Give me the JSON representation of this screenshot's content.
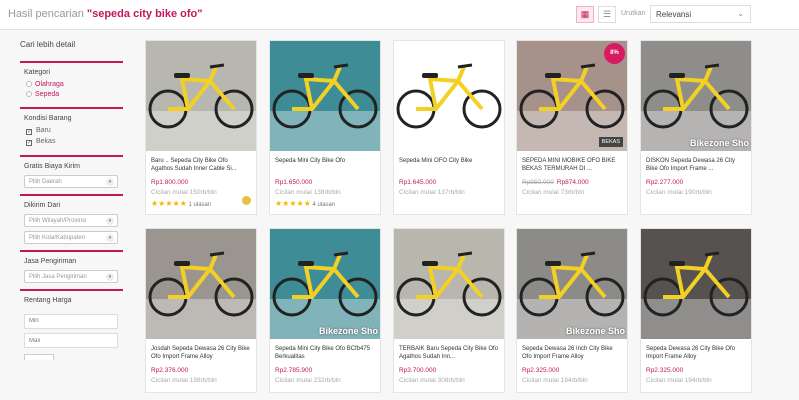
{
  "header": {
    "search_prefix": "Hasil pencarian",
    "search_query": "\"sepeda city bike ofo\"",
    "sort_label": "Urutkan",
    "sort_value": "Relevansi"
  },
  "sidebar": {
    "heading": "Cari lebih detail",
    "kategori": {
      "title": "Kategori",
      "options": [
        "Olahraga",
        "Sepeda"
      ]
    },
    "kondisi": {
      "title": "Kondisi Barang",
      "options": [
        "Baru",
        "Bekas"
      ]
    },
    "gratis": {
      "title": "Gratis Biaya Kirim",
      "select": "Pilih Daerah"
    },
    "dikirim": {
      "title": "Dikirim Dari",
      "select1": "Pilih Wilayah/Provinsi",
      "select2": "Pilih Kota/Kabupaten"
    },
    "jasa": {
      "title": "Jasa Pengiriman",
      "select": "Pilih Jasa Pengiriman"
    },
    "harga": {
      "title": "Rentang Harga",
      "min_placeholder": "Min",
      "max_placeholder": "Max"
    }
  },
  "products": [
    {
      "name": "Baru .. Sepeda City Bike Ofo Agathos Sudah Inner Cable Si...",
      "price": "Rp1.800.000",
      "cicilan": "Cicilan mulai 150rb/bln",
      "rating": "★★★★★",
      "reviews": "1 ulasan",
      "bg": "#b7b7b0"
    },
    {
      "name": "Sepeda Mini City Bike Ofo",
      "price": "Rp1.650.000",
      "cicilan": "Cicilan mulai 138rb/bln",
      "rating": "★★★★★",
      "reviews": "4 ulasan",
      "bg": "#3d8c96"
    },
    {
      "name": "Sepeda Mini OFO City Bike",
      "price": "Rp1.645.000",
      "cicilan": "Cicilan mulai 137rb/bln",
      "bg": "#ffffff"
    },
    {
      "name": "SEPEDA MINI MOBIKE OFO BIKE BEKAS TERMURAH DI ...",
      "old_price": "Rp950.000",
      "price": "Rp874.000",
      "cicilan": "Cicilan mulai 73rb/bln",
      "badge": "8%",
      "tag": "BEKAS",
      "bg": "#a6928a"
    },
    {
      "name": "DISKON Sepeda Dewasa 26 City Bike Ofo Import Frame ...",
      "price": "Rp2.277.000",
      "cicilan": "Cicilan mulai 190rb/bln",
      "watermark": "Bikezone Sho",
      "bg": "#8f8d8a"
    },
    {
      "name": "Josdah Sepeda Dewasa 26 City Bike Ofo Import Frame Alloy",
      "price": "Rp2.376.000",
      "cicilan": "Cicilan mulai 198rb/bln",
      "bg": "#9a968f"
    },
    {
      "name": "Sepeda Mini City Bike Ofo BCfb475 Berkualitas",
      "price": "Rp2.785.900",
      "cicilan": "Cicilan mulai 232rb/bln",
      "watermark": "Bikezone Sho",
      "bg": "#3d8c96"
    },
    {
      "name": "TERBAIK Baru Sepeda City Bike Ofo Agathos Sudah Inn...",
      "price": "Rp3.700.000",
      "cicilan": "Cicilan mulai 308rb/bln",
      "bg": "#b9b6ae"
    },
    {
      "name": "Sepeda Dewasa 26 Inch City Bike Ofo Import Frame Alloy",
      "price": "Rp2.325.000",
      "cicilan": "Cicilan mulai 194rb/bln",
      "watermark": "Bikezone Sho",
      "bg": "#8d8b87"
    },
    {
      "name": "Sepeda Dewasa 26 City Bike Ofo Import Frame Alloy",
      "price": "Rp2.325.000",
      "cicilan": "Cicilan mulai 194rb/bln",
      "bg": "#55524f"
    }
  ],
  "icons": {
    "grid_view": "grid-icon",
    "list_view": "list-icon"
  },
  "colors": {
    "accent": "#c2185b",
    "bike_yellow": "#f2d024"
  }
}
